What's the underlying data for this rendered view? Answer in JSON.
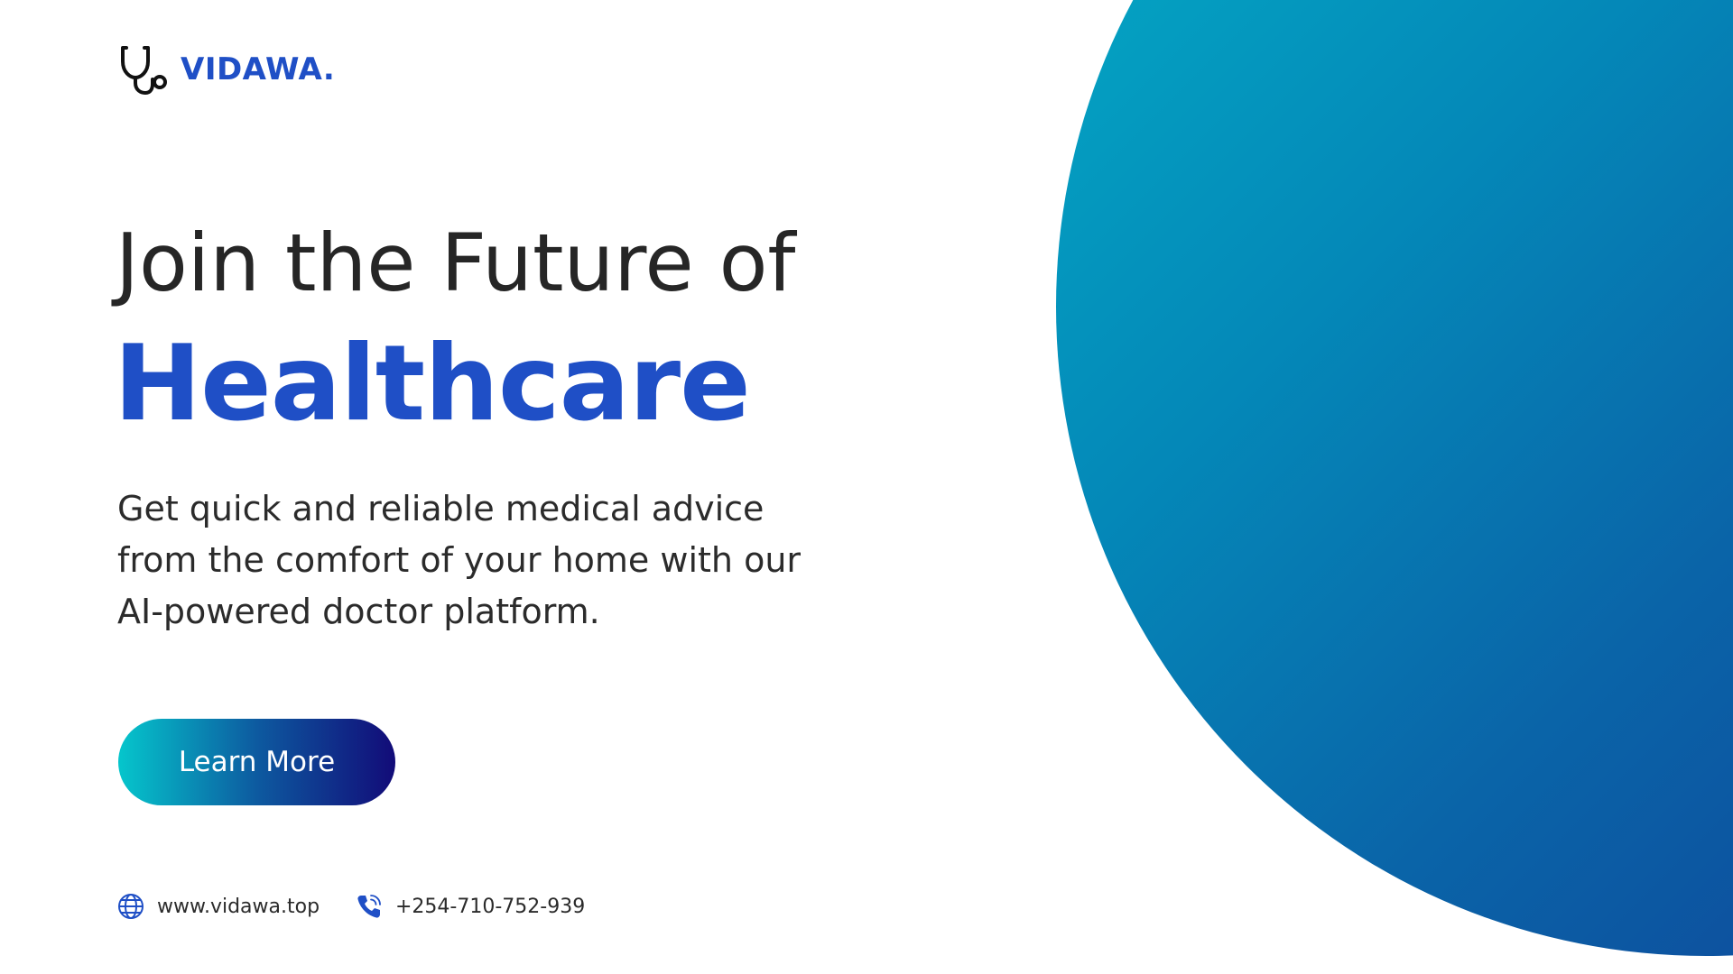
{
  "brand": {
    "name": "VIDAWA.",
    "logo_icon": "stethoscope-icon",
    "color": "#1f4fc6"
  },
  "hero": {
    "headline": "Join the Future of",
    "headline_accent": "Healthcare",
    "description": "Get quick and reliable medical advice from the comfort of your home with our AI-powered doctor platform.",
    "cta_label": "Learn More"
  },
  "contact": {
    "website": "www.vidawa.top",
    "website_icon": "globe-icon",
    "phone": "+254-710-752-939",
    "phone_icon": "phone-icon"
  },
  "colors": {
    "accent": "#1f4fc6",
    "text": "#262626",
    "circle_gradient_start": "#03b3c9",
    "circle_gradient_end": "#123893",
    "button_gradient_start": "#05c6cc",
    "button_gradient_end": "#120b78"
  }
}
